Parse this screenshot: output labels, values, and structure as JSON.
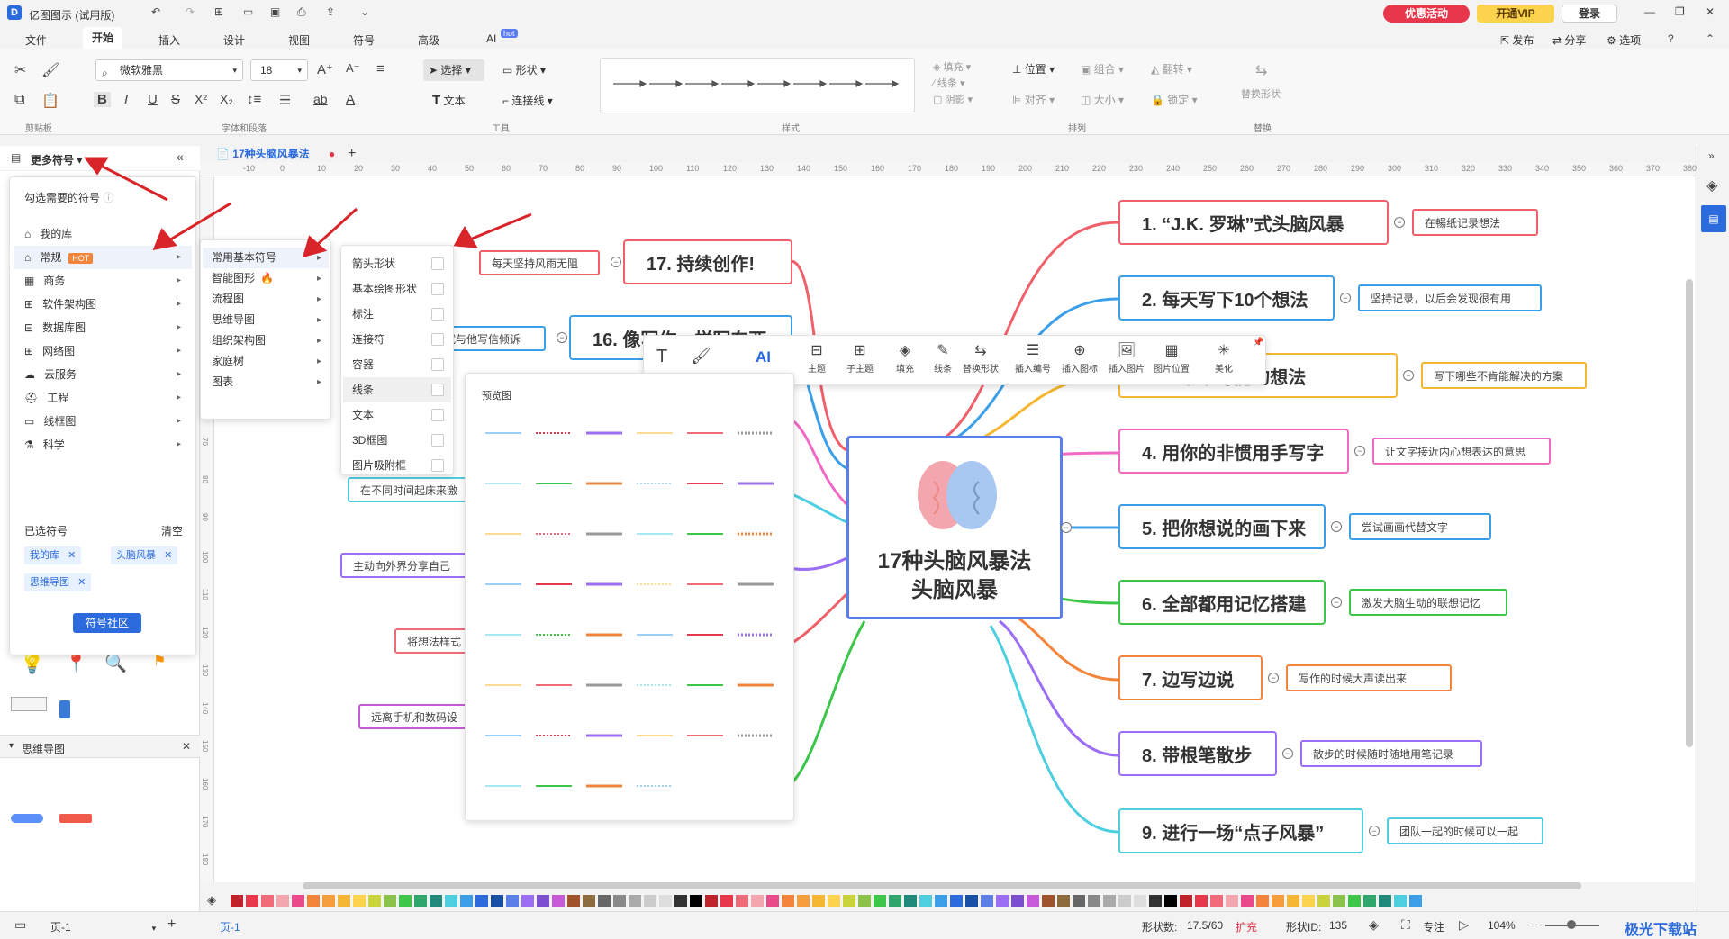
{
  "app": {
    "title": "亿图图示 (试用版)"
  },
  "titlebar": {
    "promo": "优惠活动",
    "vip": "开通VIP",
    "login": "登录"
  },
  "menu": [
    "文件",
    "开始",
    "插入",
    "设计",
    "视图",
    "符号",
    "高级",
    "AI"
  ],
  "menu_ai_badge": "hot",
  "menu_right": [
    "发布",
    "分享",
    "选项"
  ],
  "ribbon": {
    "font_name": "微软雅黑",
    "font_size": "18",
    "select": "选择",
    "shape": "形状",
    "text": "文本",
    "connector": "连接线",
    "fill": "填充",
    "line": "线条",
    "shadow": "阴影",
    "position": "位置",
    "group": "组合",
    "flip": "翻转",
    "align": "对齐",
    "size": "大小",
    "lock": "锁定",
    "replace_shape": "替换形状",
    "groups": [
      "剪贴板",
      "字体和段落",
      "工具",
      "样式",
      "排列",
      "替换"
    ]
  },
  "left_panel": {
    "header": "更多符号",
    "subtitle": "勾选需要的符号",
    "categories": [
      "我的库",
      "常规",
      "商务",
      "软件架构图",
      "数据库图",
      "网络图",
      "云服务",
      "工程",
      "线框图",
      "科学"
    ],
    "hot_badge": "HOT",
    "selected_title": "已选符号",
    "clear": "清空",
    "selected_tags": [
      "我的库",
      "头脑风暴",
      "思维导图"
    ],
    "community_button": "符号社区",
    "section2_title": "思维导图"
  },
  "submenu1": [
    "常用基本符号",
    "智能图形",
    "流程图",
    "思维导图",
    "组织架构图",
    "家庭树",
    "图表"
  ],
  "submenu2": [
    "箭头形状",
    "基本绘图形状",
    "标注",
    "连接符",
    "容器",
    "线条",
    "文本",
    "3D框图",
    "图片吸附框"
  ],
  "preview": {
    "title": "预览图"
  },
  "doc_tab": {
    "name": "17种头脑风暴法"
  },
  "ruler_h": [
    "-10",
    "0",
    "10",
    "20",
    "30",
    "40",
    "50",
    "60",
    "70",
    "80",
    "90",
    "100",
    "110",
    "120",
    "130",
    "140",
    "150",
    "160",
    "170",
    "180",
    "190",
    "200",
    "210",
    "220",
    "230",
    "240",
    "250",
    "260",
    "270",
    "280",
    "290",
    "300",
    "310",
    "320",
    "330",
    "340",
    "350",
    "360",
    "370",
    "380"
  ],
  "ruler_v": [
    "20",
    "30",
    "40",
    "50",
    "60",
    "70",
    "80",
    "90",
    "100",
    "110",
    "120",
    "130",
    "140",
    "150",
    "160",
    "170",
    "180"
  ],
  "floating_toolbar": [
    "主题",
    "子主题",
    "填充",
    "线条",
    "替换形状",
    "插入编号",
    "插入图标",
    "插入图片",
    "图片位置",
    "美化"
  ],
  "mindmap": {
    "center": [
      "17种头脑风暴法",
      "头脑风暴"
    ],
    "right_nodes": [
      {
        "label": "1. “J.K. 罗琳”式头脑风暴",
        "leaf": "在暢纸记录想法",
        "color": "#f0606a"
      },
      {
        "label": "2. 每天写下10个想法",
        "leaf": "坚持记录，以后会发现很有用",
        "color": "#3b9ee8"
      },
      {
        "label": "3. 写下不可能的想法",
        "leaf": "写下哪些不肯能解决的方案",
        "color": "#f5b731"
      },
      {
        "label": "4. 用你的非惯用手写字",
        "leaf": "让文字接近内心想表达的意思",
        "color": "#f06ac4"
      },
      {
        "label": "5. 把你想说的画下来",
        "leaf": "尝试画画代替文字",
        "color": "#3b9ee8"
      },
      {
        "label": "6. 全部都用记忆搭建",
        "leaf": "激发大脑生动的联想记忆",
        "color": "#3cc64a"
      },
      {
        "label": "7. 边写边说",
        "leaf": "写作的时候大声读出来",
        "color": "#f5843b"
      },
      {
        "label": "8. 带根笔散步",
        "leaf": "散步的时候随时随地用笔记录",
        "color": "#9b6ef5"
      },
      {
        "label": "9. 进行一场“点子风暴”",
        "leaf": "团队一起的时候可以一起",
        "color": "#4dcfe0"
      }
    ],
    "left_nodes": [
      {
        "label": "17. 持续创作!",
        "leaf": "每天坚持风雨无阻",
        "color": "#f0606a"
      },
      {
        "label": "16. 像写作一样写东西",
        "leaf": "试与他写信倾诉",
        "color": "#3b9ee8"
      }
    ],
    "left_leaves": [
      "在不同时间起床来激",
      "主动向外界分享自己",
      "将想法样式",
      "远离手机和数码设"
    ]
  },
  "status": {
    "page": "页-1",
    "page_tab": "页-1",
    "shape_count_label": "形状数:",
    "shape_count": "17.5/60",
    "expand": "扩充",
    "shape_id_label": "形状ID:",
    "shape_id": "135",
    "focus": "专注",
    "zoom": "104%"
  },
  "watermark": "极光下载站"
}
